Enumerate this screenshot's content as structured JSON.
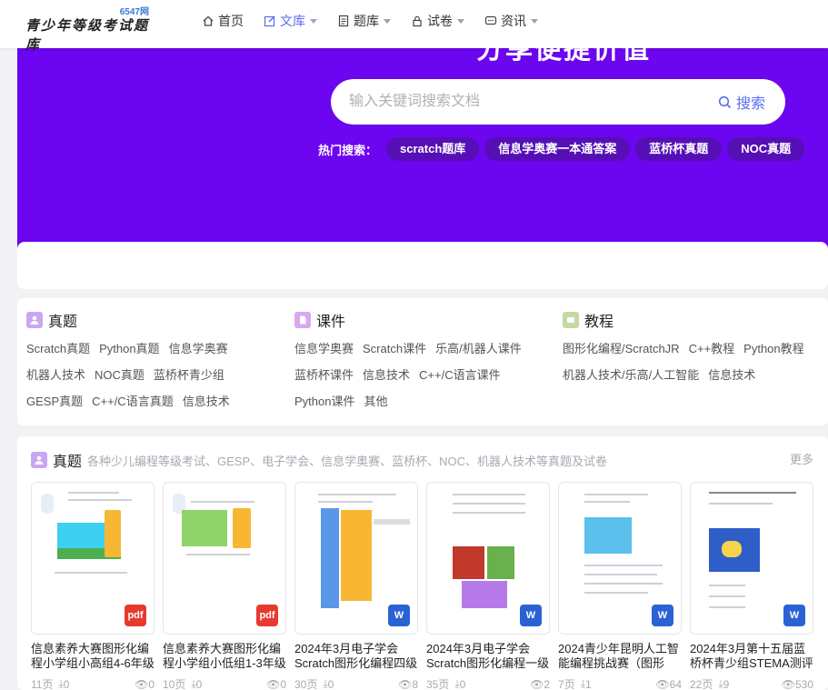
{
  "header": {
    "logo_sup": "6547网",
    "logo_main": "青少年等级考试题库",
    "nav": [
      {
        "label": "首页",
        "icon": "home-icon",
        "active": false,
        "dropdown": false
      },
      {
        "label": "文库",
        "icon": "edit-icon",
        "active": true,
        "dropdown": true
      },
      {
        "label": "题库",
        "icon": "clipboard-icon",
        "active": false,
        "dropdown": true
      },
      {
        "label": "试卷",
        "icon": "lock-icon",
        "active": false,
        "dropdown": true
      },
      {
        "label": "资讯",
        "icon": "chat-icon",
        "active": false,
        "dropdown": true
      }
    ]
  },
  "hero": {
    "title": "分享便捷价值",
    "search_placeholder": "输入关键词搜索文档",
    "search_button": "搜索",
    "hot_label": "热门搜索：",
    "hot_tags": [
      "scratch题库",
      "信息学奥赛一本通答案",
      "蓝桥杯真题",
      "NOC真题"
    ],
    "bg_color": "#6c05f0"
  },
  "categories": [
    {
      "title": "真题",
      "icon": "person-icon",
      "badge_color": "#c9a6f2",
      "links": [
        "Scratch真题",
        "Python真题",
        "信息学奥赛",
        "机器人技术",
        "NOC真题",
        "蓝桥杯青少组",
        "GESP真题",
        "C++/C语言真题",
        "信息技术"
      ]
    },
    {
      "title": "课件",
      "icon": "document-icon",
      "badge_color": "#d9a6f2",
      "links": [
        "信息学奥赛",
        "Scratch课件",
        "乐高/机器人课件",
        "蓝桥杯课件",
        "信息技术",
        "C++/C语言课件",
        "Python课件",
        "其他"
      ]
    },
    {
      "title": "教程",
      "icon": "book-icon",
      "badge_color": "#c8d9a0",
      "links": [
        "图形化编程/ScratchJR",
        "C++教程",
        "Python教程",
        "机器人技术/乐高/人工智能",
        "信息技术"
      ]
    }
  ],
  "exam_section": {
    "title": "真题",
    "description": "各种少儿编程等级考试、GESP、电子学会、信息学奥赛、蓝桥杯、NOC、机器人技术等真题及试卷",
    "more": "更多",
    "docs": [
      {
        "title": "信息素养大赛图形化编程小学组小高组4-6年级",
        "pages": "11页",
        "downloads": "0",
        "views": "0",
        "type": "pdf",
        "type_label": "pdf"
      },
      {
        "title": "信息素养大赛图形化编程小学组小低组1-3年级",
        "pages": "10页",
        "downloads": "0",
        "views": "0",
        "type": "pdf",
        "type_label": "pdf"
      },
      {
        "title": "2024年3月电子学会Scratch图形化编程四级",
        "pages": "30页",
        "downloads": "0",
        "views": "8",
        "type": "word",
        "type_label": "W"
      },
      {
        "title": "2024年3月电子学会Scratch图形化编程一级",
        "pages": "35页",
        "downloads": "0",
        "views": "2",
        "type": "word",
        "type_label": "W"
      },
      {
        "title": "2024青少年昆明人工智能编程挑战赛（图形化）",
        "pages": "7页",
        "downloads": "1",
        "views": "64",
        "type": "word",
        "type_label": "W"
      },
      {
        "title": "2024年3月第十五届蓝桥杯青少组STEMA测评",
        "pages": "22页",
        "downloads": "9",
        "views": "530",
        "type": "word",
        "type_label": "W"
      }
    ]
  }
}
